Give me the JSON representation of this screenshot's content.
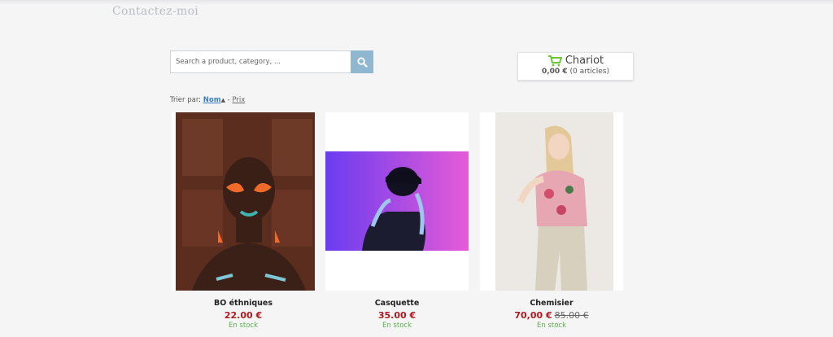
{
  "header": {
    "contact_link": "Contactez-moi"
  },
  "search": {
    "placeholder": "Search a product, category, ..."
  },
  "cart": {
    "title": "Chariot",
    "amount": "0,00 €",
    "count": "(0 articles)"
  },
  "sort": {
    "label": "Trier par:",
    "by_name": "Nom",
    "separator": "-",
    "by_price": "Prix"
  },
  "products": [
    {
      "name": "BO éthniques",
      "price": "22.00 €",
      "old_price": "",
      "stock": "En stock"
    },
    {
      "name": "Casquette",
      "price": "35.00 €",
      "old_price": "",
      "stock": "En stock"
    },
    {
      "name": "Chemisier",
      "price": "70,00 €",
      "old_price": "85.00 €",
      "stock": "En stock"
    }
  ],
  "colors": {
    "accent": "#8fb8d0",
    "price": "#b0191e",
    "stock": "#5bb04a",
    "cart_icon": "#6cc63a"
  }
}
